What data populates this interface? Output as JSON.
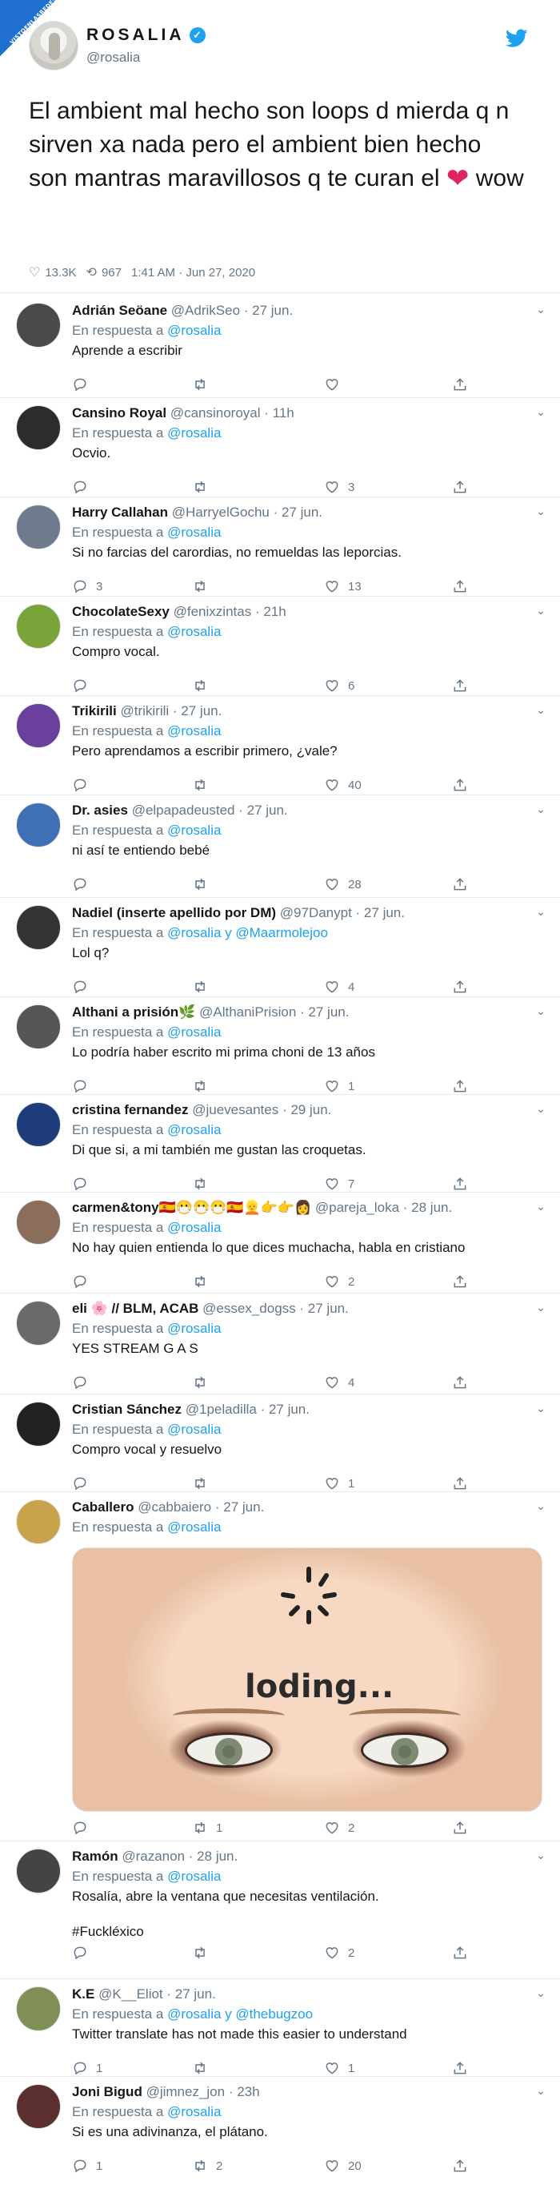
{
  "watermark": "VISTOENLASREDES",
  "main": {
    "name": "ROSALIA",
    "verified_mark": "✓",
    "handle": "@rosalia",
    "text_before": "El ambient mal hecho son loops d mierda q n sirven xa nada pero el ambient bien hecho son mantras maravillosos q te curan el",
    "heart": "❤",
    "text_after": "wow",
    "likes": "13.3K",
    "retweets": "967",
    "timestamp": "1:41 AM · Jun 27, 2020"
  },
  "icons": {
    "reply": "reply-icon",
    "retweet": "retweet-icon",
    "like": "heart-icon",
    "share": "share-icon",
    "caret": "chevron-down-icon"
  },
  "colors": {
    "accent": "#1da1f2",
    "muted": "#657786",
    "text": "#14171a",
    "heart": "#e0245e"
  },
  "replies": [
    {
      "name": "Adrián Seöane",
      "handle": "@AdrikSeo",
      "time": "· 27 jun.",
      "resp_prefix": "En respuesta a",
      "mentions": "@rosalia",
      "text": "Aprende a escribir",
      "replies": "",
      "retweets": "",
      "likes": ""
    },
    {
      "name": "Cansino Royal",
      "handle": "@cansinoroyal",
      "time": "· 11h",
      "resp_prefix": "En respuesta a",
      "mentions": "@rosalia",
      "text": "Ocvio.",
      "replies": "",
      "retweets": "",
      "likes": "3"
    },
    {
      "name": "Harry Callahan",
      "handle": "@HarryelGochu",
      "time": "· 27 jun.",
      "resp_prefix": "En respuesta a",
      "mentions": "@rosalia",
      "text": "Si no farcias del carordias, no remueldas las leporcias.",
      "replies": "3",
      "retweets": "",
      "likes": "13"
    },
    {
      "name": "ChocolateSexy",
      "handle": "@fenixzintas",
      "time": "· 21h",
      "resp_prefix": "En respuesta a",
      "mentions": "@rosalia",
      "text": "Compro vocal.",
      "replies": "",
      "retweets": "",
      "likes": "6"
    },
    {
      "name": "Trikirili",
      "handle": "@trikirili",
      "time": "· 27 jun.",
      "resp_prefix": "En respuesta a",
      "mentions": "@rosalia",
      "text": "Pero aprendamos a escribir primero, ¿vale?",
      "replies": "",
      "retweets": "",
      "likes": "40"
    },
    {
      "name": "Dr. asies",
      "handle": "@elpapadeusted",
      "time": "· 27 jun.",
      "resp_prefix": "En respuesta a",
      "mentions": "@rosalia",
      "text": "ni así te entiendo bebé",
      "replies": "",
      "retweets": "",
      "likes": "28"
    },
    {
      "name": "Nadiel (inserte apellido por DM)",
      "handle": "@97Danypt",
      "time": "· 27 jun.",
      "resp_prefix": "En respuesta a",
      "mentions": "@rosalia y @Maarmolejoo",
      "text": "Lol q?",
      "replies": "",
      "retweets": "",
      "likes": "4"
    },
    {
      "name": "Althani a prisión🌿",
      "handle": "@AlthaniPrision",
      "time": "· 27 jun.",
      "resp_prefix": "En respuesta a",
      "mentions": "@rosalia",
      "text": "Lo podría haber escrito mi prima choni de 13 años",
      "replies": "",
      "retweets": "",
      "likes": "1"
    },
    {
      "name": "cristina fernandez",
      "handle": "@juevesantes",
      "time": "· 29 jun.",
      "resp_prefix": "En respuesta a",
      "mentions": "@rosalia",
      "text": "Di que si, a mi también me gustan las croquetas.",
      "replies": "",
      "retweets": "",
      "likes": "7"
    },
    {
      "name": "carmen&tony🇪🇸😷😷😷🇪🇸👱👉👉👩",
      "handle": "@pareja_loka",
      "time": "· 28 jun.",
      "resp_prefix": "En respuesta a",
      "mentions": "@rosalia",
      "text": "No hay quien entienda lo que dices muchacha, habla en cristiano",
      "replies": "",
      "retweets": "",
      "likes": "2"
    },
    {
      "name": "eli 🌸 // BLM, ACAB",
      "handle": "@essex_dogss",
      "time": "· 27 jun.",
      "resp_prefix": "En respuesta a",
      "mentions": "@rosalia",
      "text": "YES STREAM  G A S",
      "replies": "",
      "retweets": "",
      "likes": "4"
    },
    {
      "name": "Cristian Sánchez",
      "handle": "@1peladilla",
      "time": "· 27 jun.",
      "resp_prefix": "En respuesta a",
      "mentions": "@rosalia",
      "text": "Compro vocal y resuelvo",
      "replies": "",
      "retweets": "",
      "likes": "1"
    },
    {
      "name": "Caballero",
      "handle": "@cabbaiero",
      "time": "· 27 jun.",
      "resp_prefix": "En respuesta a",
      "mentions": "@rosalia",
      "text": "",
      "media_text": "loding...",
      "replies": "",
      "retweets": "1",
      "likes": "2"
    },
    {
      "name": "Ramón",
      "handle": "@razanon",
      "time": "· 28 jun.",
      "resp_prefix": "En respuesta a",
      "mentions": "@rosalia",
      "text": "Rosalía, abre la ventana que necesitas ventilación.",
      "hashtag": "#Fuckléxico",
      "replies": "",
      "retweets": "",
      "likes": "2"
    },
    {
      "name": "K.E",
      "handle": "@K__Eliot",
      "time": "· 27 jun.",
      "resp_prefix": "En respuesta a",
      "mentions": "@rosalia y @thebugzoo",
      "text": "Twitter translate has not made this easier to understand",
      "replies": "1",
      "retweets": "",
      "likes": "1"
    },
    {
      "name": "Joni Bigud",
      "handle": "@jimnez_jon",
      "time": "· 23h",
      "resp_prefix": "En respuesta a",
      "mentions": "@rosalia",
      "text": "Si es una adivinanza, el plátano.",
      "replies": "1",
      "retweets": "2",
      "likes": "20"
    }
  ]
}
